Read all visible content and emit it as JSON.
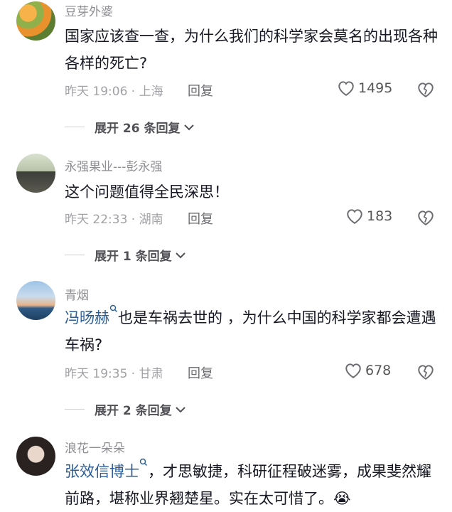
{
  "comments": [
    {
      "username": "豆芽外婆",
      "mention": "",
      "text": "国家应该查一查，为什么我们的科学家会莫名的出现各种各样的死亡?",
      "meta": "昨天 19:06 · 上海",
      "reply_label": "回复",
      "likes": "1495",
      "expand_label": "展开 26 条回复"
    },
    {
      "username": "永强果业---彭永强",
      "mention": "",
      "text": "这个问题值得全民深思！",
      "meta": "昨天 22:33 · 湖南",
      "reply_label": "回复",
      "likes": "183",
      "expand_label": "展开 1 条回复"
    },
    {
      "username": "青烟",
      "mention": "冯旸赫",
      "text": "也是车祸去世的 ，为什么中国的科学家都会遭遇车祸?",
      "meta": "昨天 19:35 · 甘肃",
      "reply_label": "回复",
      "likes": "678",
      "expand_label": "展开 2 条回复"
    },
    {
      "username": "浪花一朵朵",
      "mention": "张效信博士",
      "text": "，才思敏捷，科研征程破迷雾，成果斐然耀前路，堪称业界翘楚星。实在太可惜了。😭"
    }
  ],
  "colors": {
    "mention": "#2b5d99",
    "text": "#161823",
    "meta": "#a1a1a6"
  },
  "icons": [
    "heart-icon",
    "heart-broken-icon",
    "chevron-down-icon",
    "search-mention-icon"
  ]
}
